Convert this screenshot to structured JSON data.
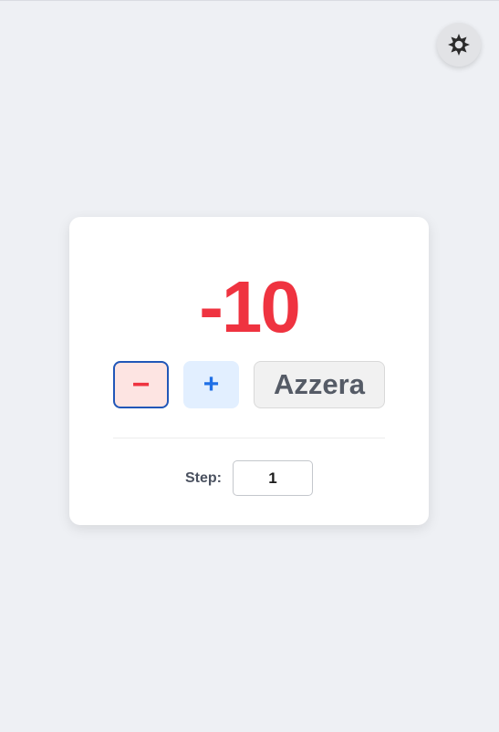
{
  "theme_toggle": {
    "icon": "sun-icon",
    "icon_color": "#2b2b2b"
  },
  "counter": {
    "value": "-10",
    "value_color": "#ef3340"
  },
  "buttons": {
    "decrement_label": "−",
    "increment_label": "+",
    "reset_label": "Azzera"
  },
  "step": {
    "label": "Step:",
    "value": "1"
  }
}
